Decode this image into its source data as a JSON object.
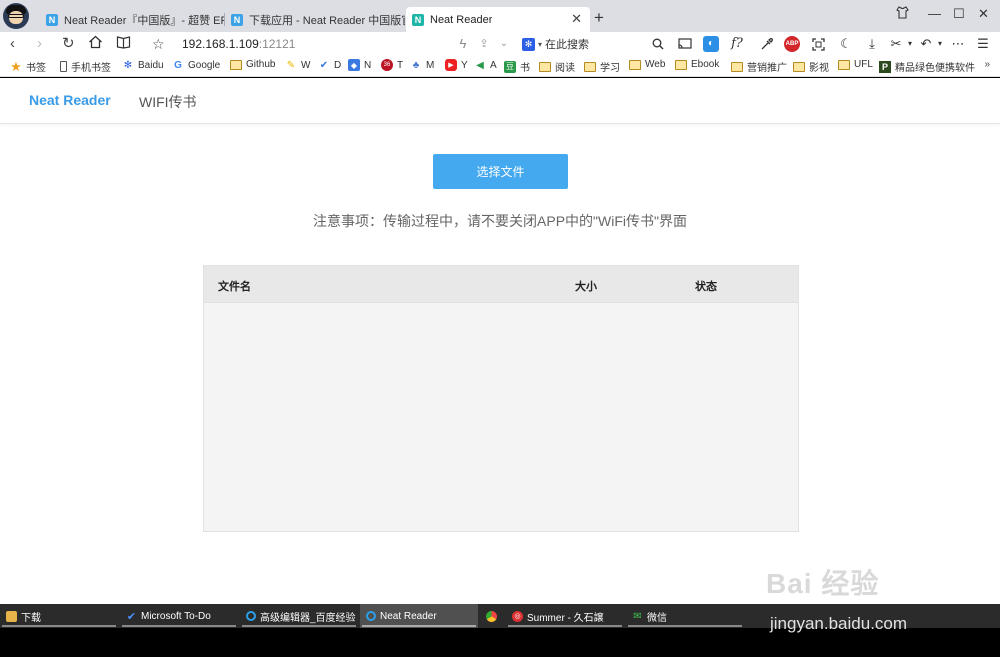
{
  "browser": {
    "tabs": [
      {
        "title": "Neat Reader『中国版』- 超赞 EPUB",
        "favicon": "N",
        "active": false
      },
      {
        "title": "下载应用 - Neat Reader 中国版官网",
        "favicon": "N",
        "active": false
      },
      {
        "title": "Neat Reader",
        "favicon": "N",
        "active": true
      }
    ],
    "new_tab": "+",
    "url": {
      "host": "192.168.1.109",
      "port": ":12121"
    },
    "search_placeholder": "在此搜索",
    "toolbar_labels": {
      "formula": "f?",
      "abp": "ABP"
    }
  },
  "bookmarks": [
    {
      "label": "书签",
      "icon": "star-icon"
    },
    {
      "label": "手机书签",
      "icon": "phone-icon"
    },
    {
      "label": "Baidu",
      "icon": "paw-icon"
    },
    {
      "label": "Google",
      "icon": "google-icon"
    },
    {
      "label": "Github",
      "icon": "folder-icon"
    },
    {
      "label": "W",
      "icon": "pen-icon"
    },
    {
      "label": "D",
      "icon": "check-icon"
    },
    {
      "label": "N",
      "icon": "n-icon"
    },
    {
      "label": "T",
      "icon": "t-icon"
    },
    {
      "label": "M",
      "icon": "m-icon"
    },
    {
      "label": "Y",
      "icon": "youtube-icon"
    },
    {
      "label": "A",
      "icon": "send-icon"
    },
    {
      "label": "书",
      "icon": "douban-icon"
    },
    {
      "label": "阅读",
      "icon": "folder-icon"
    },
    {
      "label": "学习",
      "icon": "folder-icon"
    },
    {
      "label": "Web",
      "icon": "folder-icon"
    },
    {
      "label": "Ebook",
      "icon": "folder-icon"
    },
    {
      "label": "营销推广",
      "icon": "folder-icon"
    },
    {
      "label": "影视",
      "icon": "folder-icon"
    },
    {
      "label": "UFL",
      "icon": "folder-icon"
    },
    {
      "label": "精品绿色便携软件",
      "icon": "p-icon"
    }
  ],
  "bookmarks_more": "»",
  "app": {
    "brand": "Neat Reader",
    "nav_item": "WIFI传书",
    "choose_button": "选择文件",
    "notice": "注意事项：传输过程中，请不要关闭APP中的\"WiFi传书\"界面",
    "table": {
      "headers": {
        "name": "文件名",
        "size": "大小",
        "status": "状态"
      },
      "rows": []
    }
  },
  "taskbar": [
    {
      "label": "下载",
      "icon": "folder-icon",
      "color": "#e6b34a"
    },
    {
      "label": "Microsoft To-Do",
      "icon": "todo-icon",
      "color": "#2f7be6"
    },
    {
      "label": "高级编辑器_百度经验",
      "icon": "browser-icon",
      "color": "#1aa0e8"
    },
    {
      "label": "Neat Reader",
      "icon": "browser-icon",
      "color": "#1aa0e8"
    },
    {
      "label": "",
      "icon": "chrome-icon",
      "color": "#e44"
    },
    {
      "label": "Summer - 久石譲",
      "icon": "netease-music-icon",
      "color": "#d33"
    },
    {
      "label": "微信",
      "icon": "wechat-icon",
      "color": "#2aae3c"
    }
  ],
  "watermark": {
    "logo": "Bai 经验",
    "url": "jingyan.baidu.com"
  },
  "colors": {
    "accent": "#45a9ef",
    "brand": "#3a9be8",
    "taskbar": "#2b2b2b"
  }
}
